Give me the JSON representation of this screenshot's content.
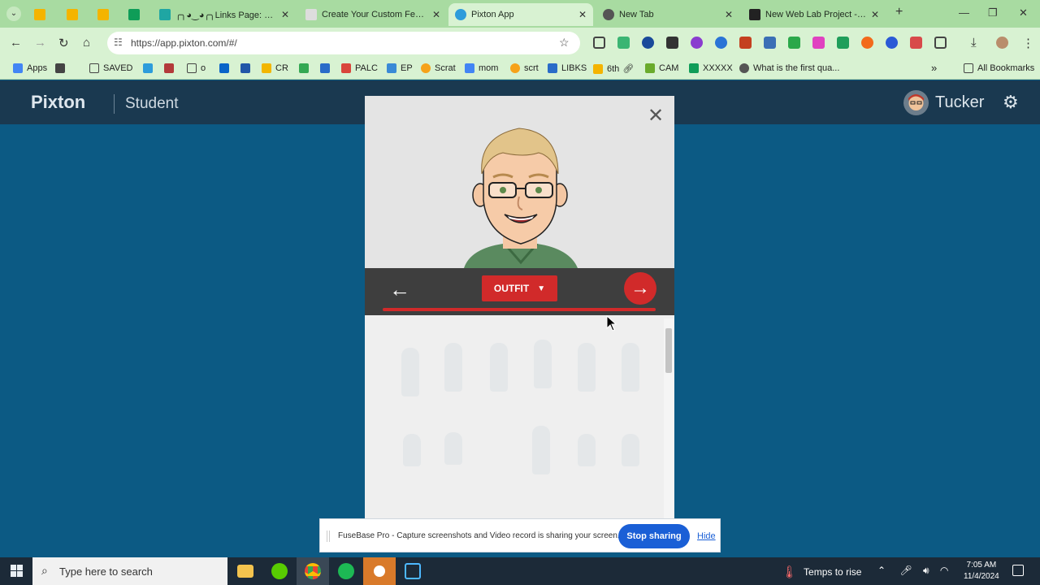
{
  "tabs": [
    {
      "label": "",
      "active": false,
      "color": "#f4b400"
    },
    {
      "label": "",
      "active": false,
      "color": "#f4b400"
    },
    {
      "label": "",
      "active": false,
      "color": "#f4b400"
    },
    {
      "label": "",
      "active": false,
      "color": "#0f9d58"
    },
    {
      "label": "╭╮◕‿◕╭╮Links Page: LIN",
      "active": false,
      "color": "#1fa6a3"
    },
    {
      "label": "Create Your Custom Female",
      "active": false,
      "color": "#ccc"
    },
    {
      "label": "Pixton App",
      "active": true,
      "color": "#2d9cdb"
    },
    {
      "label": "New Tab",
      "active": false,
      "color": "#555"
    },
    {
      "label": "New Web Lab Project - Cod",
      "active": false,
      "color": "#222"
    }
  ],
  "address": {
    "url": "https://app.pixton.com/#/"
  },
  "bookmarks": [
    {
      "label": "Apps"
    },
    {
      "label": "SAVED"
    },
    {
      "label": "o"
    },
    {
      "label": "CR"
    },
    {
      "label": "PALC"
    },
    {
      "label": "EP"
    },
    {
      "label": "Scrat"
    },
    {
      "label": "mom"
    },
    {
      "label": "scrt"
    },
    {
      "label": "LIBKS"
    },
    {
      "label": "6th"
    },
    {
      "label": "CAM"
    },
    {
      "label": "XXXXX"
    },
    {
      "label": "What is the first qua..."
    },
    {
      "label": "All Bookmarks"
    }
  ],
  "pixton": {
    "logo": "Pixton",
    "section": "Student",
    "username": "Tucker"
  },
  "editor": {
    "category_label": "OUTFIT",
    "close_label": "✕",
    "back_label": "←",
    "next_label": "→"
  },
  "sharebar": {
    "message": "FuseBase Pro - Capture screenshots and Video record is sharing your screen.",
    "stop_label": "Stop sharing",
    "hide_label": "Hide"
  },
  "taskbar": {
    "search_placeholder": "Type here to search",
    "weather": "Temps to rise",
    "time": "7:05 AM",
    "date": "11/4/2024"
  },
  "colors": {
    "page_bg": "#0c5a84",
    "accent_red": "#d12a2a",
    "chrome_green": "#a8dba1"
  }
}
